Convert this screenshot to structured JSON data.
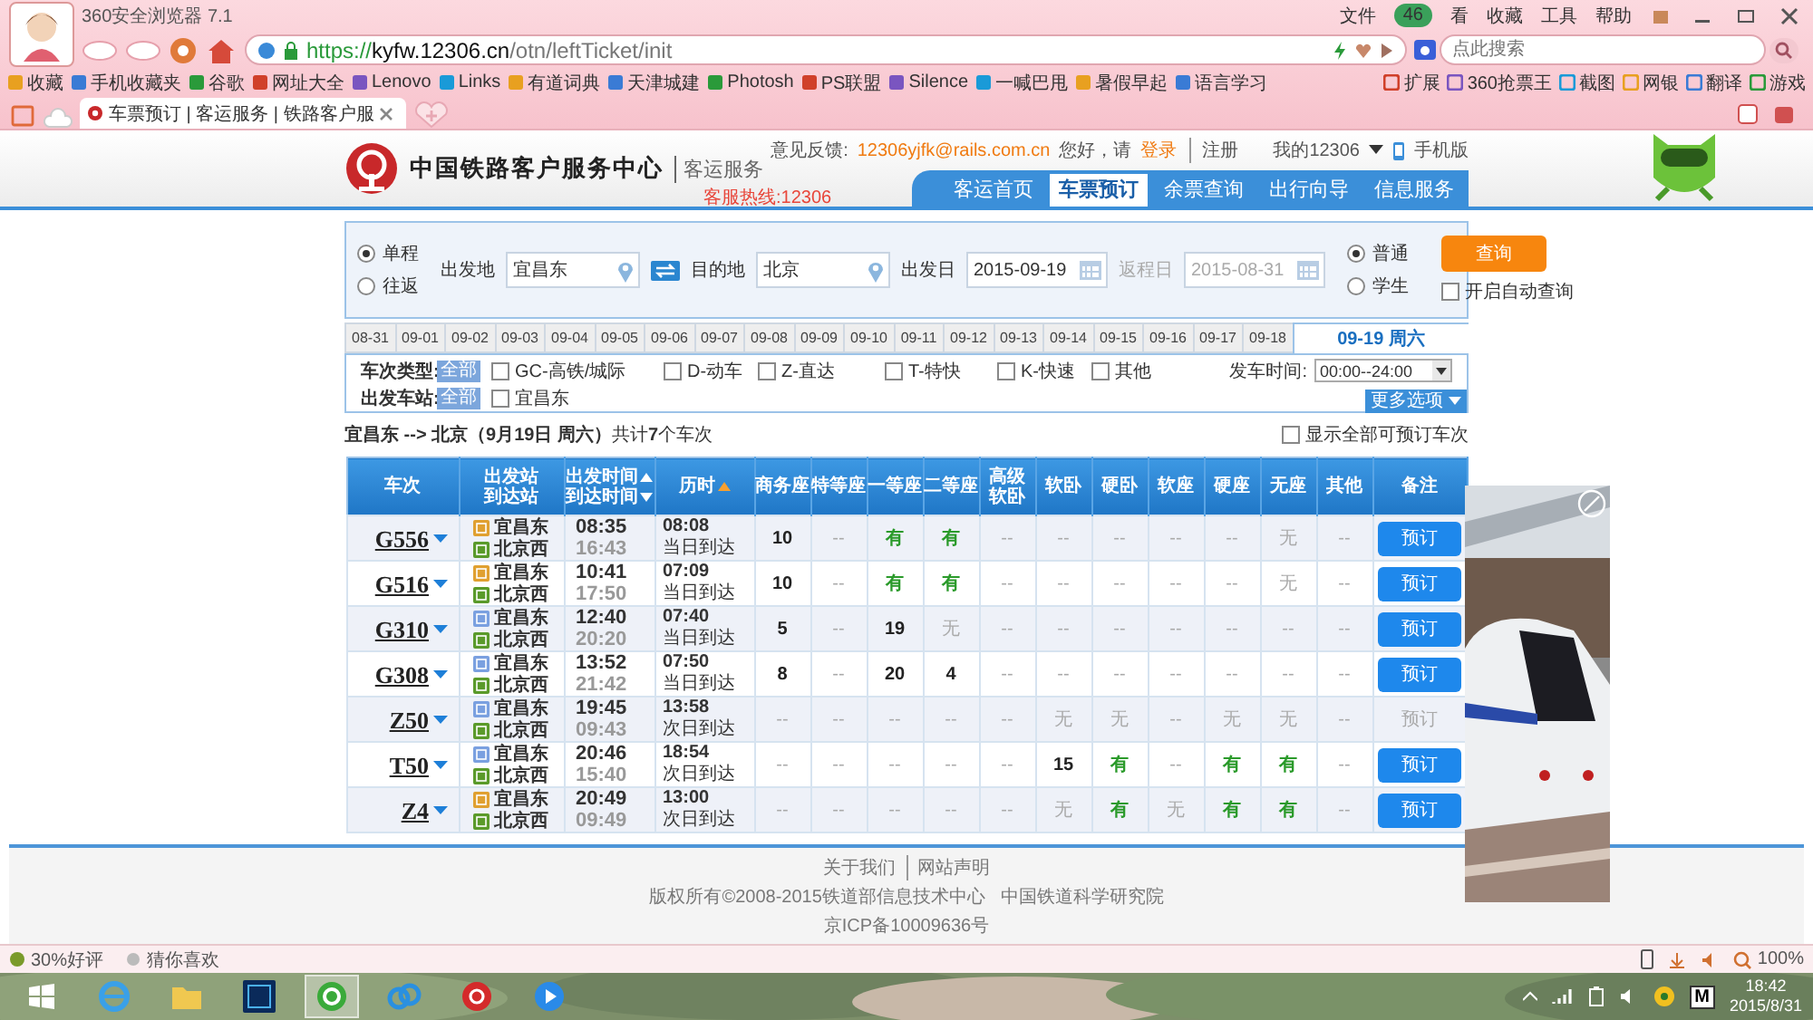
{
  "browser": {
    "title": "360安全浏览器 7.1",
    "menu": [
      "文件",
      "看",
      "收藏",
      "工具",
      "帮助"
    ],
    "badge": "46",
    "address": {
      "scheme": "https://",
      "host": "kyfw.12306.cn",
      "path": "/otn/leftTicket/init"
    },
    "search": {
      "placeholder": "点此搜索"
    },
    "bookmarks": [
      "收藏",
      "手机收藏夹",
      "谷歌",
      "网址大全",
      "Lenovo",
      "Links",
      "有道词典",
      "天津城建",
      "Photosh",
      "PS联盟",
      "Silence",
      "一喊巴甩",
      "暑假早起",
      "语言学习"
    ],
    "tools": [
      "扩展",
      "360抢票王",
      "截图",
      "网银",
      "翻译",
      "游戏"
    ],
    "tabs": [
      {
        "label": "车票预订 | 客运服务 | 铁路客户服",
        "selected": true
      }
    ]
  },
  "header": {
    "title": "中国铁路客户服务中心",
    "subtitle": "客运服务",
    "hotline": "客服热线:12306",
    "feedback_label": "意见反馈:",
    "feedback_email": "12306yjfk@rails.com.cn",
    "greeting": "您好，请",
    "login": "登录",
    "register": "注册",
    "account": "我的12306",
    "mobile": "手机版",
    "nav": [
      {
        "label": "客运首页",
        "selected": false
      },
      {
        "label": "车票预订",
        "selected": true
      },
      {
        "label": "余票查询",
        "selected": false
      },
      {
        "label": "出行向导",
        "selected": false
      },
      {
        "label": "信息服务",
        "selected": false
      }
    ]
  },
  "form": {
    "trip": [
      {
        "label": "单程",
        "selected": true
      },
      {
        "label": "往返",
        "selected": false
      }
    ],
    "from": {
      "label": "出发地",
      "value": "宜昌东"
    },
    "to": {
      "label": "目的地",
      "value": "北京"
    },
    "date": {
      "label": "出发日",
      "value": "2015-09-19",
      "disabled": false
    },
    "return": {
      "label": "返程日",
      "value": "2015-08-31",
      "disabled": true
    },
    "passenger": [
      {
        "label": "普通",
        "selected": true
      },
      {
        "label": "学生",
        "selected": false
      }
    ],
    "query": "查询",
    "auto_query": {
      "label": "开启自动查询",
      "checked": false
    }
  },
  "dates": [
    {
      "label": "08-31",
      "selected": false
    },
    {
      "label": "09-01",
      "selected": false
    },
    {
      "label": "09-02",
      "selected": false
    },
    {
      "label": "09-03",
      "selected": false
    },
    {
      "label": "09-04",
      "selected": false
    },
    {
      "label": "09-05",
      "selected": false
    },
    {
      "label": "09-06",
      "selected": false
    },
    {
      "label": "09-07",
      "selected": false
    },
    {
      "label": "09-08",
      "selected": false
    },
    {
      "label": "09-09",
      "selected": false
    },
    {
      "label": "09-10",
      "selected": false
    },
    {
      "label": "09-11",
      "selected": false
    },
    {
      "label": "09-12",
      "selected": false
    },
    {
      "label": "09-13",
      "selected": false
    },
    {
      "label": "09-14",
      "selected": false
    },
    {
      "label": "09-15",
      "selected": false
    },
    {
      "label": "09-16",
      "selected": false
    },
    {
      "label": "09-17",
      "selected": false
    },
    {
      "label": "09-18",
      "selected": false
    },
    {
      "label": "09-19 周六",
      "selected": true
    }
  ],
  "filters": {
    "type_label": "车次类型:",
    "type_all": "全部",
    "types": [
      {
        "label": "GC-高铁/城际",
        "checked": false
      },
      {
        "label": "D-动车",
        "checked": false
      },
      {
        "label": "Z-直达",
        "checked": false
      },
      {
        "label": "T-特快",
        "checked": false
      },
      {
        "label": "K-快速",
        "checked": false
      },
      {
        "label": "其他",
        "checked": false
      }
    ],
    "time_label": "发车时间:",
    "time_value": "00:00--24:00",
    "station_label": "出发车站:",
    "station_all": "全部",
    "stations": [
      {
        "label": "宜昌东",
        "checked": false
      }
    ],
    "more": "更多选项"
  },
  "summary": {
    "text": "**宜昌东 --> 北京（9月19日  周六）**共计**7**个车次",
    "show_all": {
      "label": "显示全部可预订车次",
      "checked": false
    }
  },
  "table": {
    "columns": [
      {
        "lines": [
          "车次"
        ],
        "kind": "plain"
      },
      {
        "lines": [
          "出发站",
          "到达站"
        ],
        "kind": "plain"
      },
      {
        "lines": [
          "出发时间",
          "到达时间"
        ],
        "kind": "sortpair"
      },
      {
        "lines": [
          "历时"
        ],
        "kind": "sorted"
      },
      {
        "lines": [
          "商务座"
        ],
        "kind": "plain"
      },
      {
        "lines": [
          "特等座"
        ],
        "kind": "plain"
      },
      {
        "lines": [
          "一等座"
        ],
        "kind": "plain"
      },
      {
        "lines": [
          "二等座"
        ],
        "kind": "plain"
      },
      {
        "lines": [
          "高级",
          "软卧"
        ],
        "kind": "plain"
      },
      {
        "lines": [
          "软卧"
        ],
        "kind": "plain"
      },
      {
        "lines": [
          "硬卧"
        ],
        "kind": "plain"
      },
      {
        "lines": [
          "软座"
        ],
        "kind": "plain"
      },
      {
        "lines": [
          "硬座"
        ],
        "kind": "plain"
      },
      {
        "lines": [
          "无座"
        ],
        "kind": "plain"
      },
      {
        "lines": [
          "其他"
        ],
        "kind": "plain"
      },
      {
        "lines": [
          "备注"
        ],
        "kind": "plain"
      }
    ],
    "rows": [
      {
        "train": "G556",
        "from": {
          "name": "宜昌东",
          "kind": "start"
        },
        "to": {
          "name": "北京西",
          "kind": "end"
        },
        "depart": "08:35",
        "arrive": "16:43",
        "duration": "08:08",
        "day": "当日到达",
        "seats": [
          {
            "text": "10",
            "kind": "count"
          },
          {
            "text": "--",
            "kind": "dash"
          },
          {
            "text": "有",
            "kind": "yes"
          },
          {
            "text": "有",
            "kind": "yes"
          },
          {
            "text": "--",
            "kind": "dash"
          },
          {
            "text": "--",
            "kind": "dash"
          },
          {
            "text": "--",
            "kind": "dash"
          },
          {
            "text": "--",
            "kind": "dash"
          },
          {
            "text": "--",
            "kind": "dash"
          },
          {
            "text": "无",
            "kind": "no"
          },
          {
            "text": "--",
            "kind": "dash"
          }
        ],
        "book": {
          "label": "预订",
          "disabled": false
        }
      },
      {
        "train": "G516",
        "from": {
          "name": "宜昌东",
          "kind": "start"
        },
        "to": {
          "name": "北京西",
          "kind": "end"
        },
        "depart": "10:41",
        "arrive": "17:50",
        "duration": "07:09",
        "day": "当日到达",
        "seats": [
          {
            "text": "10",
            "kind": "count"
          },
          {
            "text": "--",
            "kind": "dash"
          },
          {
            "text": "有",
            "kind": "yes"
          },
          {
            "text": "有",
            "kind": "yes"
          },
          {
            "text": "--",
            "kind": "dash"
          },
          {
            "text": "--",
            "kind": "dash"
          },
          {
            "text": "--",
            "kind": "dash"
          },
          {
            "text": "--",
            "kind": "dash"
          },
          {
            "text": "--",
            "kind": "dash"
          },
          {
            "text": "无",
            "kind": "no"
          },
          {
            "text": "--",
            "kind": "dash"
          }
        ],
        "book": {
          "label": "预订",
          "disabled": false
        }
      },
      {
        "train": "G310",
        "from": {
          "name": "宜昌东",
          "kind": "pass"
        },
        "to": {
          "name": "北京西",
          "kind": "end"
        },
        "depart": "12:40",
        "arrive": "20:20",
        "duration": "07:40",
        "day": "当日到达",
        "seats": [
          {
            "text": "5",
            "kind": "count"
          },
          {
            "text": "--",
            "kind": "dash"
          },
          {
            "text": "19",
            "kind": "count"
          },
          {
            "text": "无",
            "kind": "no"
          },
          {
            "text": "--",
            "kind": "dash"
          },
          {
            "text": "--",
            "kind": "dash"
          },
          {
            "text": "--",
            "kind": "dash"
          },
          {
            "text": "--",
            "kind": "dash"
          },
          {
            "text": "--",
            "kind": "dash"
          },
          {
            "text": "--",
            "kind": "dash"
          },
          {
            "text": "--",
            "kind": "dash"
          }
        ],
        "book": {
          "label": "预订",
          "disabled": false
        }
      },
      {
        "train": "G308",
        "from": {
          "name": "宜昌东",
          "kind": "pass"
        },
        "to": {
          "name": "北京西",
          "kind": "end"
        },
        "depart": "13:52",
        "arrive": "21:42",
        "duration": "07:50",
        "day": "当日到达",
        "seats": [
          {
            "text": "8",
            "kind": "count"
          },
          {
            "text": "--",
            "kind": "dash"
          },
          {
            "text": "20",
            "kind": "count"
          },
          {
            "text": "4",
            "kind": "count"
          },
          {
            "text": "--",
            "kind": "dash"
          },
          {
            "text": "--",
            "kind": "dash"
          },
          {
            "text": "--",
            "kind": "dash"
          },
          {
            "text": "--",
            "kind": "dash"
          },
          {
            "text": "--",
            "kind": "dash"
          },
          {
            "text": "--",
            "kind": "dash"
          },
          {
            "text": "--",
            "kind": "dash"
          }
        ],
        "book": {
          "label": "预订",
          "disabled": false
        }
      },
      {
        "train": "Z50",
        "from": {
          "name": "宜昌东",
          "kind": "pass"
        },
        "to": {
          "name": "北京西",
          "kind": "end"
        },
        "depart": "19:45",
        "arrive": "09:43",
        "duration": "13:58",
        "day": "次日到达",
        "seats": [
          {
            "text": "--",
            "kind": "dash"
          },
          {
            "text": "--",
            "kind": "dash"
          },
          {
            "text": "--",
            "kind": "dash"
          },
          {
            "text": "--",
            "kind": "dash"
          },
          {
            "text": "--",
            "kind": "dash"
          },
          {
            "text": "无",
            "kind": "no"
          },
          {
            "text": "无",
            "kind": "no"
          },
          {
            "text": "--",
            "kind": "dash"
          },
          {
            "text": "无",
            "kind": "no"
          },
          {
            "text": "无",
            "kind": "no"
          },
          {
            "text": "--",
            "kind": "dash"
          }
        ],
        "book": {
          "label": "预订",
          "disabled": true
        }
      },
      {
        "train": "T50",
        "from": {
          "name": "宜昌东",
          "kind": "pass"
        },
        "to": {
          "name": "北京西",
          "kind": "end"
        },
        "depart": "20:46",
        "arrive": "15:40",
        "duration": "18:54",
        "day": "次日到达",
        "seats": [
          {
            "text": "--",
            "kind": "dash"
          },
          {
            "text": "--",
            "kind": "dash"
          },
          {
            "text": "--",
            "kind": "dash"
          },
          {
            "text": "--",
            "kind": "dash"
          },
          {
            "text": "--",
            "kind": "dash"
          },
          {
            "text": "15",
            "kind": "count"
          },
          {
            "text": "有",
            "kind": "yes"
          },
          {
            "text": "--",
            "kind": "dash"
          },
          {
            "text": "有",
            "kind": "yes"
          },
          {
            "text": "有",
            "kind": "yes"
          },
          {
            "text": "--",
            "kind": "dash"
          }
        ],
        "book": {
          "label": "预订",
          "disabled": false
        }
      },
      {
        "train": "Z4",
        "from": {
          "name": "宜昌东",
          "kind": "start"
        },
        "to": {
          "name": "北京西",
          "kind": "end"
        },
        "depart": "20:49",
        "arrive": "09:49",
        "duration": "13:00",
        "day": "次日到达",
        "seats": [
          {
            "text": "--",
            "kind": "dash"
          },
          {
            "text": "--",
            "kind": "dash"
          },
          {
            "text": "--",
            "kind": "dash"
          },
          {
            "text": "--",
            "kind": "dash"
          },
          {
            "text": "--",
            "kind": "dash"
          },
          {
            "text": "无",
            "kind": "no"
          },
          {
            "text": "有",
            "kind": "yes"
          },
          {
            "text": "无",
            "kind": "no"
          },
          {
            "text": "有",
            "kind": "yes"
          },
          {
            "text": "有",
            "kind": "yes"
          },
          {
            "text": "--",
            "kind": "dash"
          }
        ],
        "book": {
          "label": "预订",
          "disabled": false
        }
      }
    ]
  },
  "footer": {
    "links": [
      "关于我们",
      "网站声明"
    ],
    "copyright": "版权所有©2008-2015铁道部信息技术中心   中国铁道科学研究院",
    "icp": "京ICP备10009636号"
  },
  "status_bar": {
    "left": [
      "30%好评",
      "猜你喜欢"
    ],
    "zoom": "100%"
  },
  "taskbar": {
    "ime": "M",
    "time": "18:42",
    "date": "2015/8/31"
  }
}
